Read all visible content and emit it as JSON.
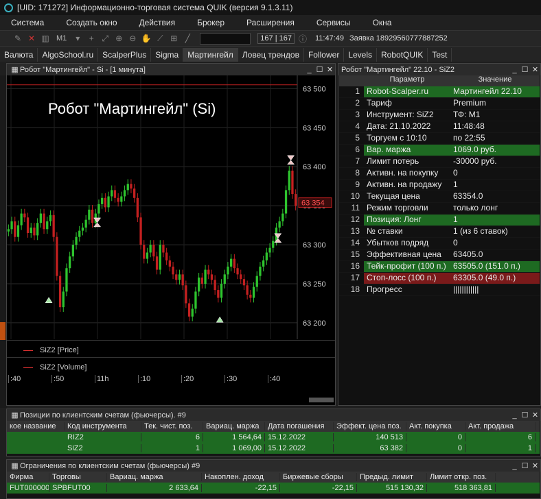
{
  "window_title": "[UID: 171272] Информационно-торговая система QUIK (версия 9.1.3.11)",
  "menu": [
    "Система",
    "Создать окно",
    "Действия",
    "Брокер",
    "Расширения",
    "Сервисы",
    "Окна"
  ],
  "toolbar": {
    "interval": "M1",
    "count": "167 | 167",
    "time": "11:47:49",
    "message": "Заявка 18929560777887252"
  },
  "tabs": [
    "Валюта",
    "AlgoSchool.ru",
    "ScalperPlus",
    "Sigma",
    "Мартингейл",
    "Ловец трендов",
    "Follower",
    "Levels",
    "RobotQUIK",
    "Test"
  ],
  "active_tab": 4,
  "chart_window": {
    "title": "Робот \"Мартингейл\" - Si - [1 минута]",
    "overlay_text": "Робот \"Мартингейл\" (Si)",
    "price_tag": "63 354",
    "legend_price": "SiZ2 [Price]",
    "legend_volume": "SiZ2 [Volume]"
  },
  "chart_data": {
    "type": "candlestick",
    "y_ticks": [
      "63 500",
      "63 450",
      "63 400",
      "63 350",
      "63 300",
      "63 250",
      "63 200"
    ],
    "y_tick_values": [
      63500,
      63450,
      63400,
      63350,
      63300,
      63250,
      63200
    ],
    "ylim": [
      63185,
      63510
    ],
    "x_ticks": [
      ":40",
      ":50",
      "11h",
      ":10",
      ":20",
      ":30",
      ":40"
    ],
    "last_price": 63354,
    "red_line": 63505,
    "closes": [
      63320,
      63330,
      63310,
      63325,
      63340,
      63335,
      63315,
      63322,
      63312,
      63328,
      63340,
      63320,
      63330,
      63338,
      63310,
      63260,
      63220,
      63240,
      63270,
      63285,
      63300,
      63310,
      63318,
      63322,
      63332,
      63345,
      63328,
      63340,
      63352,
      63360,
      63348,
      63362,
      63370,
      63360,
      63355,
      63362,
      63370,
      63378,
      63372,
      63360,
      63335,
      63300,
      63282,
      63290,
      63300,
      63285,
      63268,
      63300,
      63290,
      63280,
      63272,
      63262,
      63255,
      63262,
      63248,
      63225,
      63208,
      63218,
      63240,
      63258,
      63250,
      63268,
      63262,
      63255,
      63242,
      63232,
      63250,
      63262,
      63272,
      63282,
      63270,
      63262,
      63256,
      63248,
      63236,
      63232,
      63246,
      63260,
      63272,
      63280,
      63290,
      63296,
      63305,
      63322,
      63330,
      63340,
      63370,
      63395,
      63365,
      63350
    ]
  },
  "params_window": {
    "title": "Робот \"Мартингейл\" 22.10 - SiZ2",
    "header": {
      "param": "Параметр",
      "value": "Значение"
    },
    "rows": [
      {
        "n": "1",
        "p": "Robot-Scalper.ru",
        "v": "Мартингейл 22.10",
        "c": "g"
      },
      {
        "n": "2",
        "p": "Тариф",
        "v": "Premium",
        "c": ""
      },
      {
        "n": "3",
        "p": "Инструмент: SiZ2",
        "v": "ТФ: M1",
        "c": ""
      },
      {
        "n": "4",
        "p": "Дата: 21.10.2022",
        "v": "11:48:48",
        "c": ""
      },
      {
        "n": "5",
        "p": "Торгуем с 10:10",
        "v": "по 22:55",
        "c": ""
      },
      {
        "n": "6",
        "p": "Вар. маржа",
        "v": "1069.0 руб.",
        "c": "g"
      },
      {
        "n": "7",
        "p": "Лимит потерь",
        "v": "-30000 руб.",
        "c": ""
      },
      {
        "n": "8",
        "p": "Активн. на покупку",
        "v": "0",
        "c": ""
      },
      {
        "n": "9",
        "p": "Активн. на продажу",
        "v": "1",
        "c": ""
      },
      {
        "n": "10",
        "p": "Текущая цена",
        "v": "63354.0",
        "c": ""
      },
      {
        "n": "11",
        "p": "Режим торговли",
        "v": "только лонг",
        "c": ""
      },
      {
        "n": "12",
        "p": "Позиция: Лонг",
        "v": "1",
        "c": "g"
      },
      {
        "n": "13",
        "p": "№ ставки",
        "v": "1 (из 6 ставок)",
        "c": ""
      },
      {
        "n": "14",
        "p": "Убытков подряд",
        "v": "0",
        "c": ""
      },
      {
        "n": "15",
        "p": "Эффективная цена",
        "v": "63405.0",
        "c": ""
      },
      {
        "n": "16",
        "p": "Тейк-профит (100 п.)",
        "v": "63505.0 (151.0 п.)",
        "c": "g"
      },
      {
        "n": "17",
        "p": "Стоп-лосс (100 п.)",
        "v": "63305.0 (49.0 п.)",
        "c": "r"
      },
      {
        "n": "18",
        "p": "Прогресс",
        "v": "||||||||||||",
        "c": ""
      }
    ]
  },
  "positions_window": {
    "title": "Позиции по клиентским счетам (фьючерсы). #9",
    "columns": [
      "кое название",
      "Код инструмента",
      "Тек. чист. поз.",
      "Вариац. маржа",
      "Дата погашения",
      "Эффект. цена поз.",
      "Акт. покупка",
      "Акт. продажа"
    ],
    "rows": [
      [
        "",
        "RIZ2",
        "6",
        "1 564,64",
        "15.12.2022",
        "140 513",
        "0",
        "6"
      ],
      [
        "",
        "SiZ2",
        "1",
        "1 069,00",
        "15.12.2022",
        "63 382",
        "0",
        "1"
      ]
    ]
  },
  "limits_window": {
    "title": "Ограничения по клиентским счетам (фьючерсы) #9",
    "columns": [
      "Фирма",
      "Торговы",
      "Вариац. маржа",
      "Накоплен. доход",
      "Биржевые сборы",
      "Предыд. лимит",
      "Лимит откр. поз."
    ],
    "rows": [
      [
        "FUT000000",
        "SPBFUT00",
        "2 633,64",
        "-22,15",
        "-22,15",
        "515 130,32",
        "518 363,81"
      ]
    ]
  },
  "colors": {
    "up": "#2ec42e",
    "down": "#c42020",
    "accent_green": "#1e6a22",
    "accent_red": "#7a1a1a"
  }
}
